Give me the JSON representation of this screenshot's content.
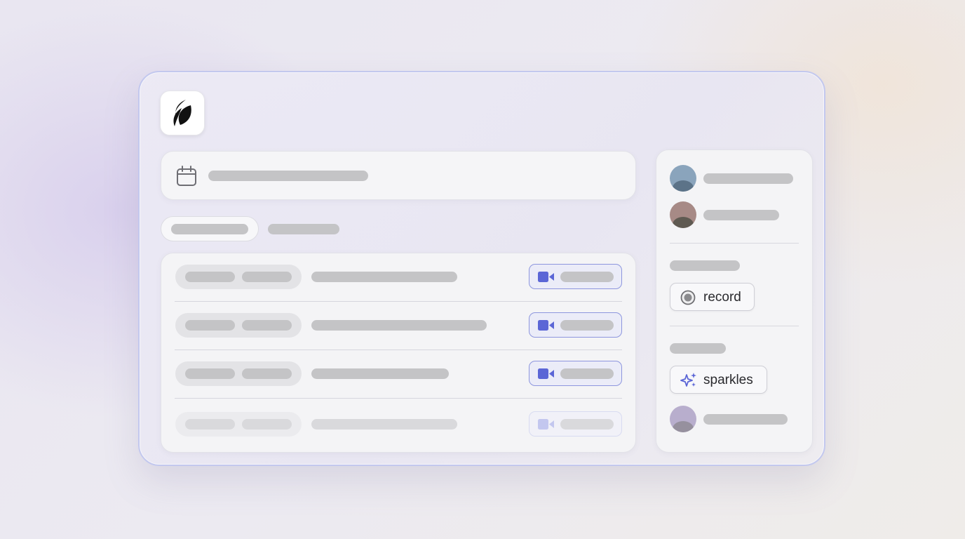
{
  "brand": {
    "logo_icon": "flame-icon"
  },
  "search": {
    "icon": "calendar-icon"
  },
  "meetings": [
    {
      "icon": "video-camera-icon",
      "faded": false
    },
    {
      "icon": "video-camera-icon",
      "faded": false
    },
    {
      "icon": "video-camera-icon",
      "faded": false
    },
    {
      "icon": "video-camera-icon",
      "faded": true
    }
  ],
  "sidebar": {
    "record_label": "record",
    "record_icon": "record-icon",
    "sparkles_label": "sparkles",
    "sparkles_icon": "sparkles-icon"
  },
  "colors": {
    "accent": "#5b66d6",
    "card_border": "#c3c8ee",
    "avatar_1": "#8aa4bc",
    "avatar_2": "#a78a86",
    "avatar_3": "#b8aecd"
  }
}
